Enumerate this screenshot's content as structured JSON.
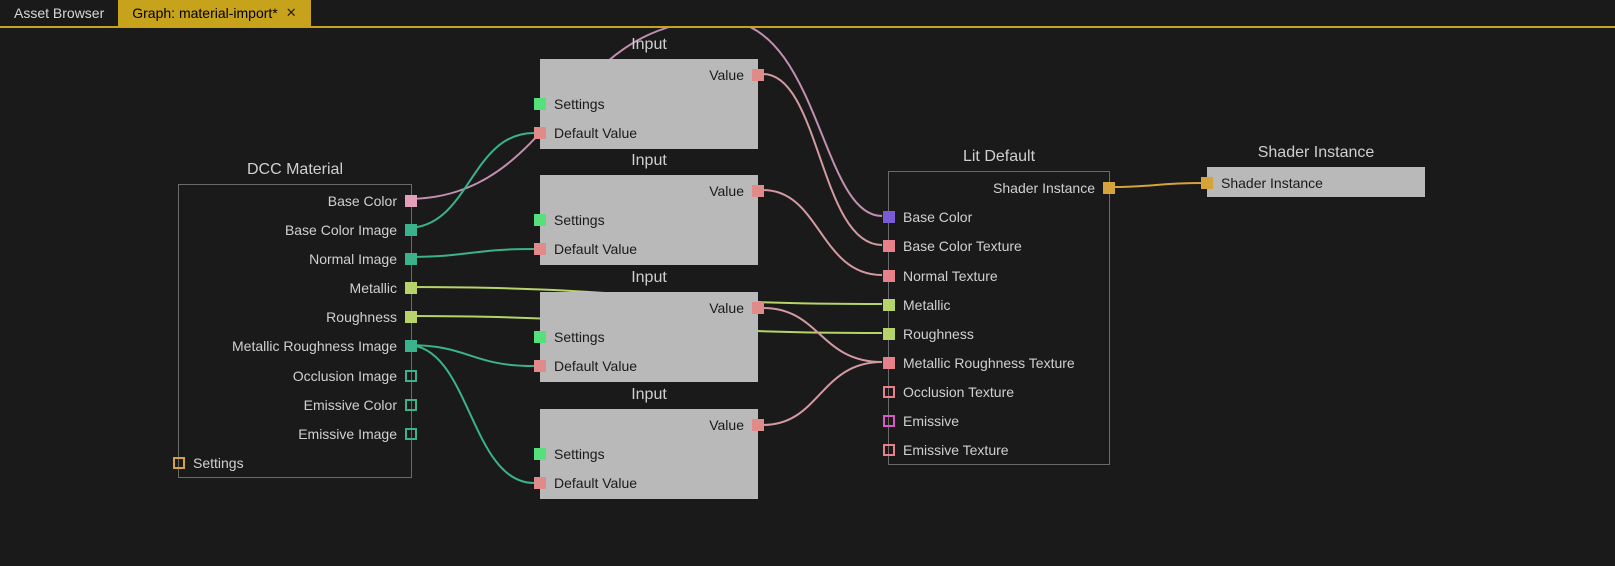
{
  "tabs": {
    "asset_browser": "Asset Browser",
    "graph": "Graph: material-import*"
  },
  "nodes": {
    "dcc": {
      "title": "DCC Material",
      "outputs": {
        "base_color": "Base Color",
        "base_color_image": "Base Color Image",
        "normal_image": "Normal Image",
        "metallic": "Metallic",
        "roughness": "Roughness",
        "metallic_roughness_image": "Metallic Roughness Image",
        "occlusion_image": "Occlusion Image",
        "emissive_color": "Emissive Color",
        "emissive_image": "Emissive Image"
      },
      "inputs": {
        "settings": "Settings"
      }
    },
    "input": {
      "title": "Input",
      "value": "Value",
      "settings": "Settings",
      "default_value": "Default Value"
    },
    "lit": {
      "title": "Lit Default",
      "outputs": {
        "shader_instance": "Shader Instance"
      },
      "inputs": {
        "base_color": "Base Color",
        "base_color_texture": "Base Color Texture",
        "normal_texture": "Normal Texture",
        "metallic": "Metallic",
        "roughness": "Roughness",
        "metallic_roughness_texture": "Metallic Roughness Texture",
        "occlusion_texture": "Occlusion Texture",
        "emissive": "Emissive",
        "emissive_texture": "Emissive Texture"
      }
    },
    "shader": {
      "title": "Shader Instance",
      "inputs": {
        "shader_instance": "Shader Instance"
      }
    }
  }
}
